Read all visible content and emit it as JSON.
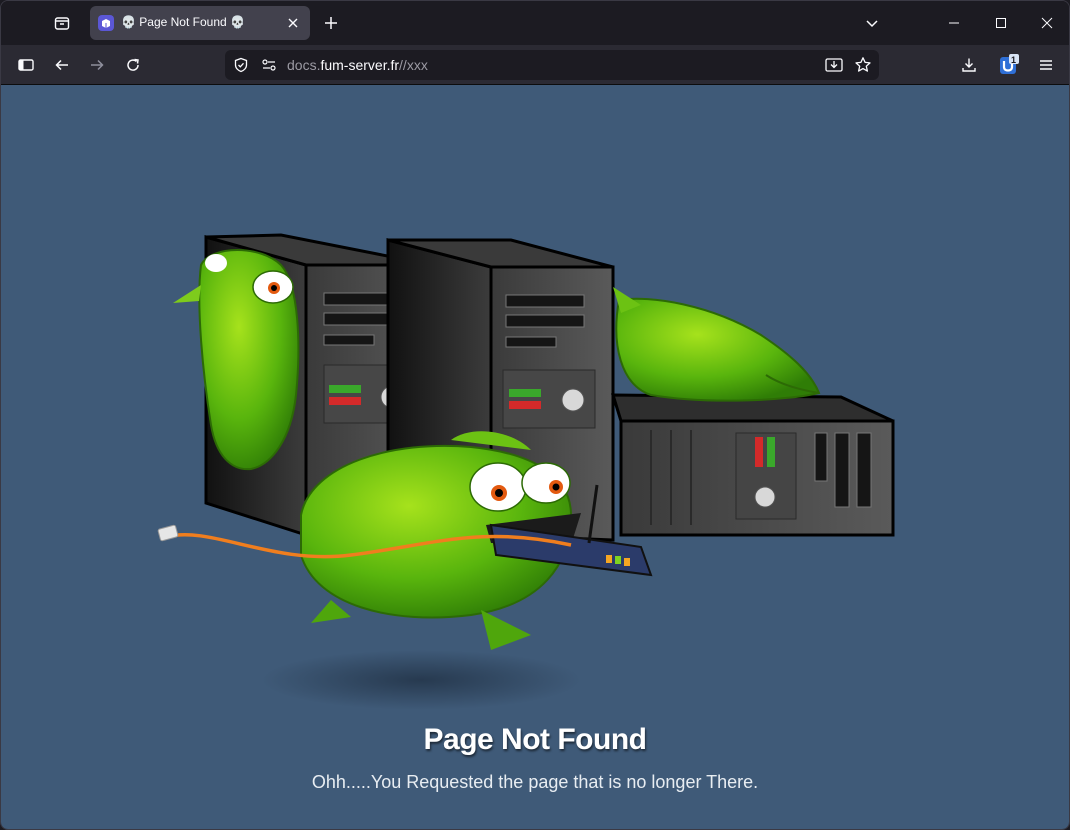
{
  "browser": {
    "tab": {
      "title": "💀 Page Not Found 💀"
    },
    "url": {
      "prefix": "docs.",
      "host": "fum-server.fr",
      "path": "//xxx"
    },
    "extension_badge": "1"
  },
  "page": {
    "heading": "Page Not Found",
    "message": "Ohh.....You Requested the page that is no longer There."
  },
  "icons": [
    "tab-overview-icon",
    "tab-favicon-icon",
    "tab-close-icon",
    "new-tab-icon",
    "list-all-tabs-icon",
    "minimize-icon",
    "maximize-icon",
    "close-window-icon",
    "sidebar-icon",
    "back-icon",
    "forward-icon",
    "reload-icon",
    "shield-icon",
    "permissions-icon",
    "install-icon",
    "bookmark-star-icon",
    "downloads-icon",
    "extension-icon",
    "menu-icon"
  ]
}
